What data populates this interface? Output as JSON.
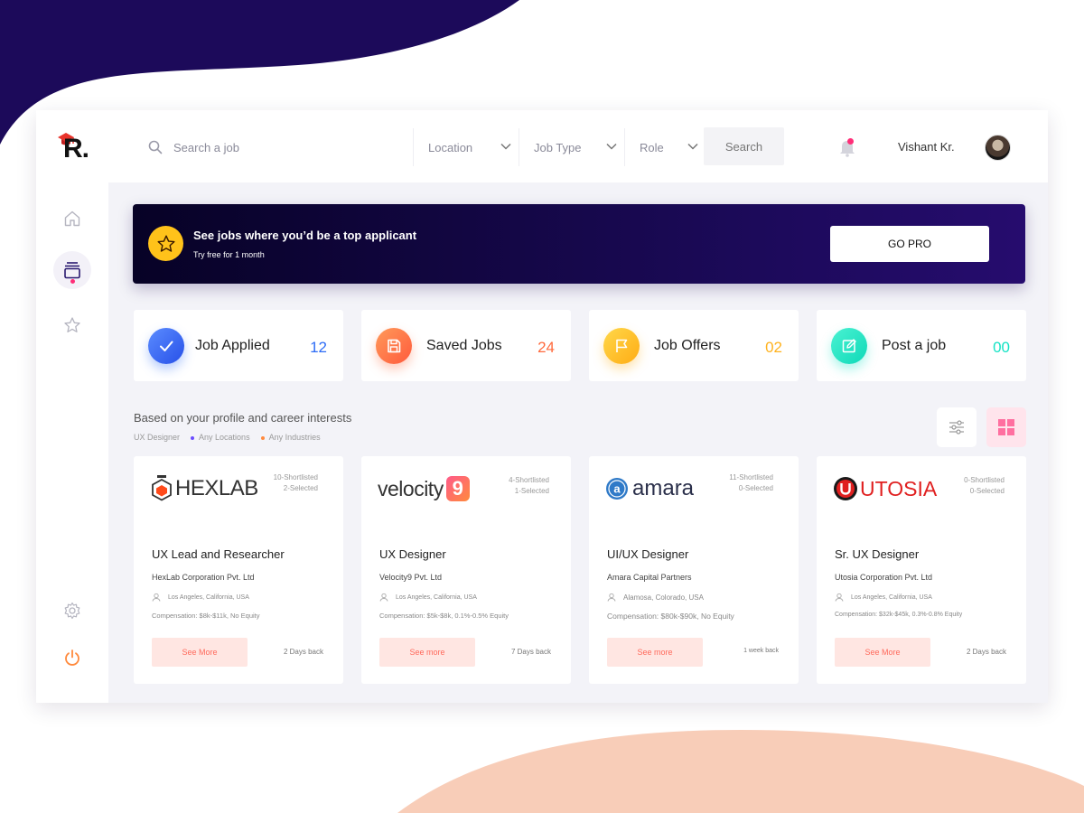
{
  "brand": {
    "logo_text": "R."
  },
  "search": {
    "placeholder": "Search a job"
  },
  "filters": [
    {
      "label": "Location"
    },
    {
      "label": "Job Type"
    },
    {
      "label": "Role"
    }
  ],
  "search_button": "Search",
  "user": {
    "name": "Vishant Kr."
  },
  "sidebar": {
    "items": [
      {
        "icon": "home-icon",
        "active": false
      },
      {
        "icon": "jobs-icon",
        "active": true
      },
      {
        "icon": "star-icon",
        "active": false
      },
      {
        "icon": "settings-icon",
        "active": false
      },
      {
        "icon": "power-icon",
        "active": false
      }
    ]
  },
  "banner": {
    "title": "See jobs where you’d be a top applicant",
    "subtitle": "Try free for 1 month",
    "cta": "GO PRO"
  },
  "stats": [
    {
      "label": "Job Applied",
      "value": "12",
      "color": "#2d6cf6",
      "icon": "check-icon"
    },
    {
      "label": "Saved Jobs",
      "value": "24",
      "color": "#ff6a3d",
      "icon": "save-icon"
    },
    {
      "label": "Job Offers",
      "value": "02",
      "color": "#ffb21e",
      "icon": "flag-icon"
    },
    {
      "label": "Post a job",
      "value": "00",
      "color": "#15e3c5",
      "icon": "edit-icon"
    }
  ],
  "recommendations": {
    "title": "Based on your profile and career interests",
    "tags": [
      "UX Designer",
      "Any Locations",
      "Any Industries"
    ]
  },
  "jobs": [
    {
      "logo": "HEXLAB",
      "shortlisted": "10-Shortlisted",
      "selected": "2-Selected",
      "title": "UX Lead and Researcher",
      "company": "HexLab Corporation Pvt. Ltd",
      "location": "Los Angeles, California, USA",
      "compensation": "Compensation: $8k-$11k, No Equity",
      "button": "See More",
      "posted": "2 Days back"
    },
    {
      "logo": "velocity",
      "logo_badge": "9",
      "shortlisted": "4-Shortlisted",
      "selected": "1-Selected",
      "title": "UX Designer",
      "company": "Velocity9 Pvt. Ltd",
      "location": "Los Angeles, California, USA",
      "compensation": "Compensation: $5k-$8k, 0.1%-0.5% Equity",
      "button": "See more",
      "posted": "7 Days back"
    },
    {
      "logo": "amara",
      "shortlisted": "11-Shortlisted",
      "selected": "0-Selected",
      "title": "UI/UX Designer",
      "company": "Amara Capital Partners",
      "location": "Alamosa, Colorado, USA",
      "compensation": "Compensation: $80k-$90k, No Equity",
      "button": "See more",
      "posted": "1 week back"
    },
    {
      "logo": "UTOSIA",
      "shortlisted": "0-Shortlisted",
      "selected": "0-Selected",
      "title": "Sr. UX Designer",
      "company": "Utosia Corporation Pvt. Ltd",
      "location": "Los Angeles, California, USA",
      "compensation": "Compensation: $32k-$45k, 0.3%-0.8% Equity",
      "button": "See More",
      "posted": "2 Days back"
    }
  ]
}
